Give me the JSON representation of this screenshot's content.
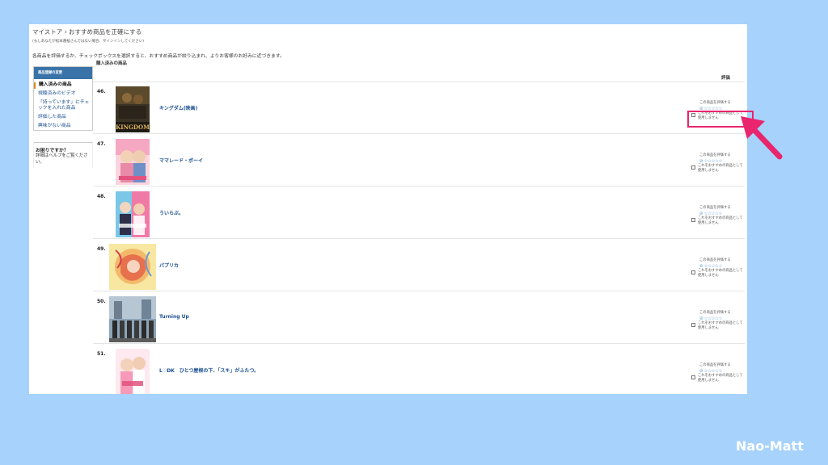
{
  "breadcrumb": "マイストア › おすすめ商品を正確にする",
  "signin_note": "(もしあなたが松本蓮桜さんではない場合、サインインしてください)",
  "instruction": "各商品を評価するか、チェックボックスを選択すると、おすすめ商品が絞り込まれ、よりお客様のお好みに近づきます。",
  "sidebar": {
    "header": "商品登録の変更",
    "items": [
      {
        "label": "購入済みの商品"
      },
      {
        "label": "視聴済みのビデオ"
      },
      {
        "label": "「持っています」にチェックを入れた商品"
      },
      {
        "label": "評価した商品"
      },
      {
        "label": "興味がない商品"
      }
    ]
  },
  "help": {
    "title": "お困りですか？",
    "text": "詳細はヘルプをご覧ください。"
  },
  "section_title": "購入済みの商品",
  "rating_header": "評価",
  "row_labels": {
    "rate_label": "この商品を評価する",
    "check_label": "これをおすすめの商品として使用しません"
  },
  "rows": [
    {
      "number": "46.",
      "title": "キングダム(映画)",
      "poster_icon": "kingdom-poster"
    },
    {
      "number": "47.",
      "title": "ママレード・ボーイ",
      "poster_icon": "marmalade-boy-poster"
    },
    {
      "number": "48.",
      "title": "ういらぶ。",
      "poster_icon": "uirabu-poster"
    },
    {
      "number": "49.",
      "title": "パプリカ",
      "poster_icon": "paprika-poster"
    },
    {
      "number": "50.",
      "title": "Turning Up",
      "poster_icon": "turning-up-poster"
    },
    {
      "number": "51.",
      "title": "L♡DK　ひとつ屋根の下、「スキ」がふたつ。",
      "poster_icon": "ldk-poster"
    }
  ],
  "stars_glyph": "⊘ ☆☆☆☆☆",
  "poster_texts": {
    "kingdom": "KINGDOM"
  },
  "colors": {
    "background": "#a6d2fb",
    "link": "#1a4f91",
    "sidebar_header": "#3a73a8",
    "highlight": "#e8256d"
  },
  "watermark": "Nao-Matt"
}
